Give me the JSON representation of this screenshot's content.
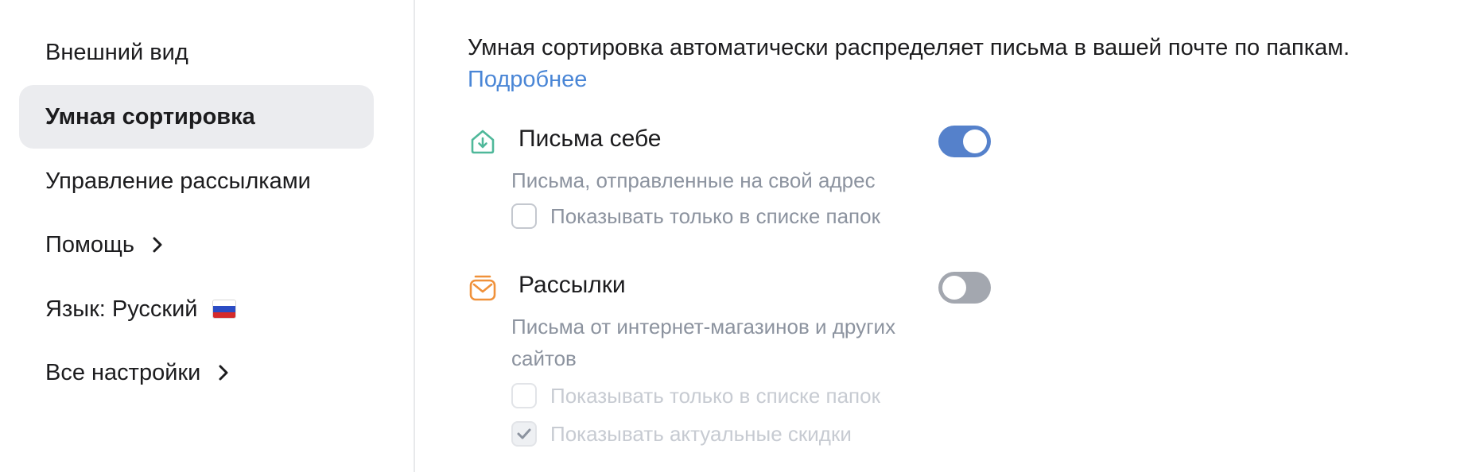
{
  "sidebar": {
    "items": [
      {
        "label": "Внешний вид"
      },
      {
        "label": "Умная сортировка"
      },
      {
        "label": "Управление рассылками"
      },
      {
        "label": "Помощь"
      },
      {
        "label": "Язык: Русский"
      },
      {
        "label": "Все настройки"
      }
    ],
    "active_index": 1
  },
  "main": {
    "intro_text": "Умная сортировка автоматически распределяет письма в вашей почте по папкам.",
    "more_link": "Подробнее",
    "sections": [
      {
        "icon": "inbox-download-icon",
        "title": "Письма себе",
        "description": "Письма, отправленные на свой адрес",
        "toggle_on": true,
        "options": [
          {
            "label": "Показывать только в списке папок",
            "checked": false,
            "disabled": false
          }
        ]
      },
      {
        "icon": "newsletter-mail-icon",
        "title": "Рассылки",
        "description": "Письма от интернет-магазинов и других сайтов",
        "toggle_on": false,
        "options": [
          {
            "label": "Показывать только в списке папок",
            "checked": false,
            "disabled": true
          },
          {
            "label": "Показывать актуальные скидки",
            "checked": true,
            "disabled": true
          }
        ]
      }
    ]
  },
  "colors": {
    "accent": "#5581cb",
    "link": "#4a86d6",
    "active_bg": "#ebecef",
    "toggle_off": "#a3a7af",
    "icon_green": "#4fb89a",
    "icon_orange": "#f0913a"
  }
}
